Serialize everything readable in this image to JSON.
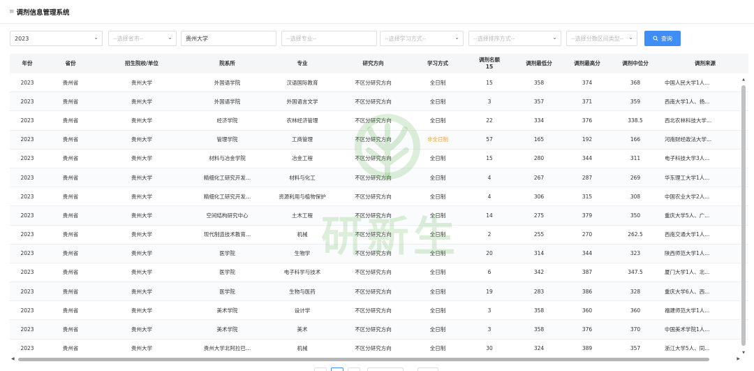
{
  "header": {
    "menu_icon": "≡",
    "title": "调剂信息管理系统"
  },
  "filters": {
    "year": "2023",
    "province_placeholder": "--选择省市--",
    "school_value": "贵州大学",
    "major_placeholder": "--选择专业--",
    "study_mode_placeholder": "--选择学习方式--",
    "sort_placeholder": "--选择排序方式--",
    "score_range_placeholder": "--选择分数区间类型--",
    "query_label": "查询"
  },
  "table": {
    "columns": [
      "年份",
      "省份",
      "招生院校/单位",
      "院系所",
      "专业",
      "研究方向",
      "学习方式",
      "调剂名额",
      "调剂最低分",
      "调剂最高分",
      "调剂中位分",
      "调剂来源"
    ],
    "quota_total": "15",
    "rows": [
      [
        "2023",
        "贵州省",
        "贵州大学",
        "外国语学院",
        "汉语国际教育",
        "不区分研究方向",
        "全日制",
        "15",
        "358",
        "374",
        "368",
        "中国人民大学1人..."
      ],
      [
        "2023",
        "贵州省",
        "贵州大学",
        "外国语学院",
        "外国语言文学",
        "不区分研究方向",
        "全日制",
        "3",
        "357",
        "371",
        "359",
        "西南大学1人、扬..."
      ],
      [
        "2023",
        "贵州省",
        "贵州大学",
        "经济学院",
        "农林经济管理",
        "不区分研究方向",
        "全日制",
        "22",
        "334",
        "376",
        "338.5",
        "西北农林科技大学..."
      ],
      [
        "2023",
        "贵州省",
        "贵州大学",
        "管理学院",
        "工商管理",
        "不区分研究方向",
        "非全日制",
        "57",
        "165",
        "192",
        "166",
        "河南财经政法大学..."
      ],
      [
        "2023",
        "贵州省",
        "贵州大学",
        "材料与冶金学院",
        "冶金工程",
        "不区分研究方向",
        "全日制",
        "15",
        "280",
        "344",
        "311",
        "电子科技大学3人..."
      ],
      [
        "2023",
        "贵州省",
        "贵州大学",
        "精细化工研究开发...",
        "材料与化工",
        "不区分研究方向",
        "全日制",
        "4",
        "267",
        "287",
        "269",
        "华东理工大学1人..."
      ],
      [
        "2023",
        "贵州省",
        "贵州大学",
        "精细化工研究开发...",
        "资源利用与植物保护",
        "不区分研究方向",
        "全日制",
        "4",
        "306",
        "315",
        "308",
        "中国农业大学2人..."
      ],
      [
        "2023",
        "贵州省",
        "贵州大学",
        "空间结构研究中心",
        "土木工程",
        "不区分研究方向",
        "全日制",
        "14",
        "275",
        "379",
        "350",
        "重庆大学5人、广..."
      ],
      [
        "2023",
        "贵州省",
        "贵州大学",
        "现代制造技术教育...",
        "机械",
        "不区分研究方向",
        "全日制",
        "2",
        "255",
        "270",
        "262.5",
        "西南交通大学1人..."
      ],
      [
        "2023",
        "贵州省",
        "贵州大学",
        "医学院",
        "生物学",
        "不区分研究方向",
        "全日制",
        "20",
        "314",
        "344",
        "323",
        "陕西师范大学1人..."
      ],
      [
        "2023",
        "贵州省",
        "贵州大学",
        "医学院",
        "电子科学与技术",
        "不区分研究方向",
        "全日制",
        "6",
        "342",
        "387",
        "347.5",
        "厦门大学1人、北..."
      ],
      [
        "2023",
        "贵州省",
        "贵州大学",
        "医学院",
        "生物与医药",
        "不区分研究方向",
        "全日制",
        "19",
        "283",
        "386",
        "328",
        "重庆大学6人、西..."
      ],
      [
        "2023",
        "贵州省",
        "贵州大学",
        "美术学院",
        "设计学",
        "不区分研究方向",
        "全日制",
        "3",
        "358",
        "360",
        "360",
        "福建师范大学1人..."
      ],
      [
        "2023",
        "贵州省",
        "贵州大学",
        "美术学院",
        "美术",
        "不区分研究方向",
        "全日制",
        "3",
        "358",
        "376",
        "370",
        "中国美术学院1人..."
      ],
      [
        "2023",
        "贵州省",
        "贵州大学",
        "贵州大学北阿拉巴...",
        "机械",
        "不区分研究方向",
        "全日制",
        "30",
        "324",
        "389",
        "357",
        "浙江大学5人、同..."
      ]
    ]
  },
  "watermark": {
    "text": "研新生"
  },
  "colors": {
    "accent": "#3f8ef7",
    "highlight": "#f0a030",
    "watermark": "#6cb45a"
  }
}
